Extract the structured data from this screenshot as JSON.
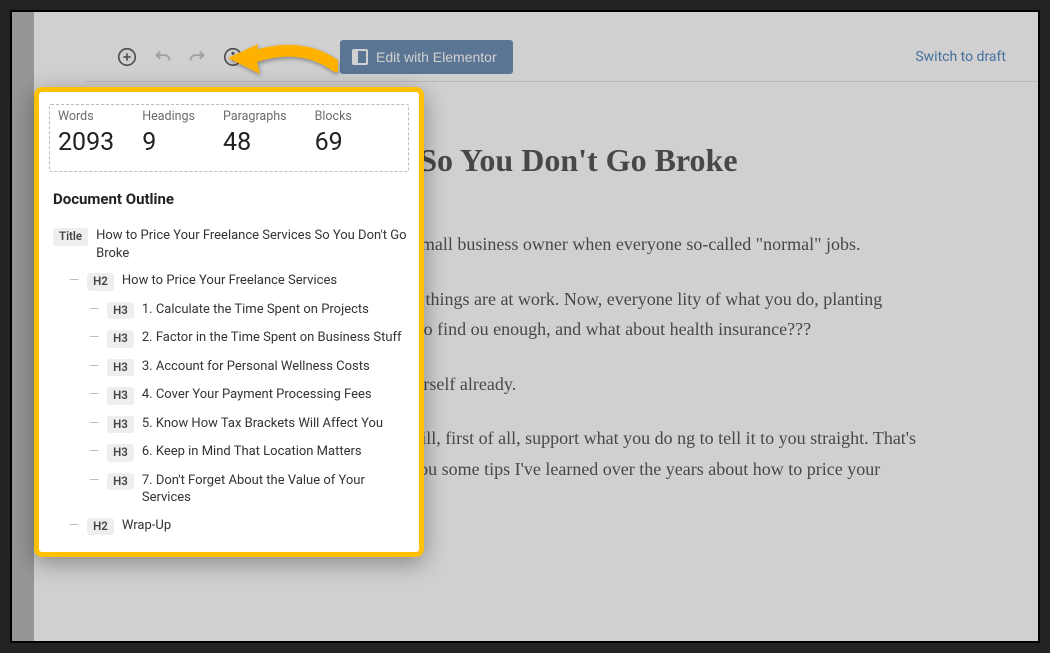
{
  "toolbar": {
    "elementor_label": "Edit with Elementor",
    "switch_draft_label": "Switch to draft"
  },
  "stats": {
    "words_label": "Words",
    "words": "2093",
    "headings_label": "Headings",
    "headings": "9",
    "paragraphs_label": "Paragraphs",
    "paragraphs": "48",
    "blocks_label": "Blocks",
    "blocks": "69"
  },
  "outline": {
    "panel_title": "Document Outline",
    "items": [
      {
        "tag": "Title",
        "indent": 0,
        "text": "How to Price Your Freelance Services So You Don't Go Broke"
      },
      {
        "tag": "H2",
        "indent": 1,
        "text": "How to Price Your Freelance Services"
      },
      {
        "tag": "H3",
        "indent": 2,
        "text": "1. Calculate the Time Spent on Projects"
      },
      {
        "tag": "H3",
        "indent": 2,
        "text": "2. Factor in the Time Spent on Business Stuff"
      },
      {
        "tag": "H3",
        "indent": 2,
        "text": "3. Account for Personal Wellness Costs"
      },
      {
        "tag": "H3",
        "indent": 2,
        "text": "4. Cover Your Payment Processing Fees"
      },
      {
        "tag": "H3",
        "indent": 2,
        "text": "5. Know How Tax Brackets Will Affect You"
      },
      {
        "tag": "H3",
        "indent": 2,
        "text": "6. Keep in Mind That Location Matters"
      },
      {
        "tag": "H3",
        "indent": 2,
        "text": "7. Don't Forget About the Value of Your Services"
      },
      {
        "tag": "H2",
        "indent": 1,
        "text": "Wrap-Up"
      }
    ]
  },
  "post": {
    "title": "elance Services So You Don't Go Broke",
    "p1": "uch it sucks to be a freelancer or small business owner when everyone so-called \"normal\" jobs.",
    "p2": "s and relatives might ask you how things are at work. Now, everyone lity of what you do, planting concerns about how you're going to find ou enough, and what about health insurance???",
    "p3": "You're putting enough of it on yourself already.",
    "p4": "ho's been through it before who will, first of all, support what you do ng to tell it to you straight. That's why, today, I want to share with you some tips I've learned over the years about how to price your freelance services so that:"
  },
  "colors": {
    "highlight": "#ffc107",
    "primary_button": "#4b76a3",
    "link": "#2b6cb0"
  }
}
